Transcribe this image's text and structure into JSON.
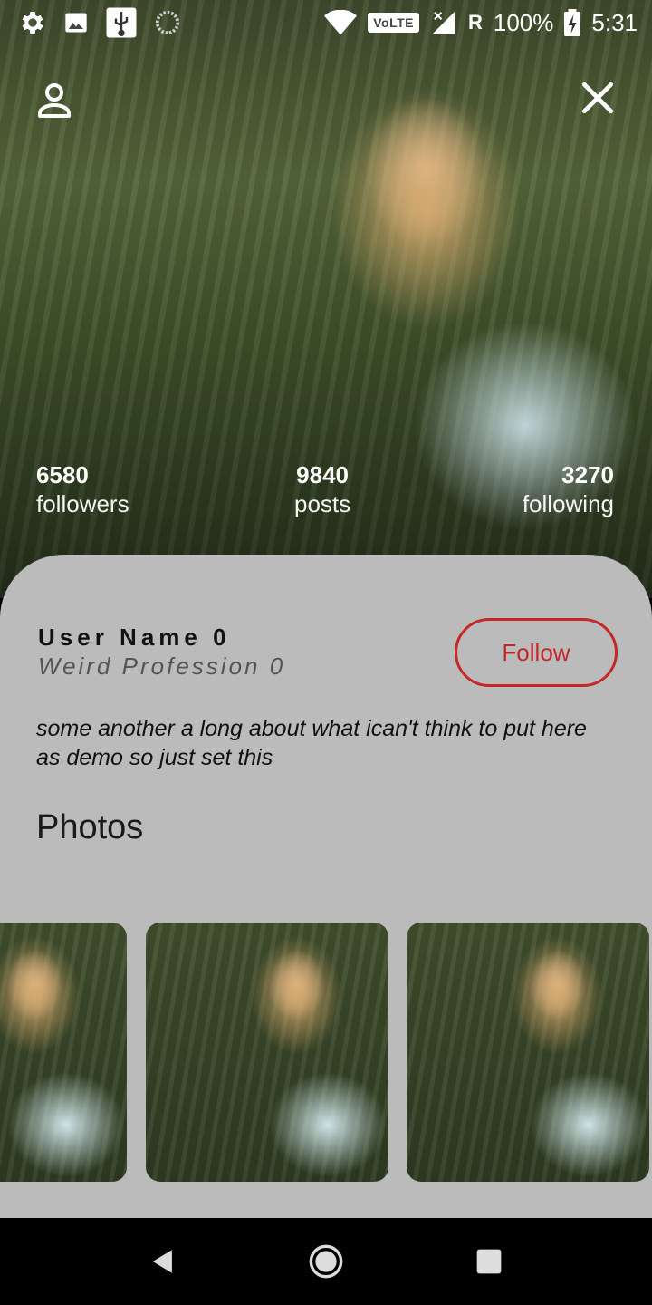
{
  "status_bar": {
    "icons": [
      "settings-icon",
      "image-icon",
      "usb-icon",
      "sync-icon"
    ],
    "network_icons": [
      "wifi-icon",
      "signal-icon"
    ],
    "volte": "VoLTE",
    "roaming": "R",
    "battery": "100%",
    "time": "5:31"
  },
  "header": {
    "profile_icon": "person-outline-icon",
    "close_icon": "close-icon"
  },
  "stats": {
    "followers_count": "6580",
    "followers_label": "followers",
    "posts_count": "9840",
    "posts_label": "posts",
    "following_count": "3270",
    "following_label": "following"
  },
  "profile": {
    "name": "User Name 0",
    "profession": "Weird Profession 0",
    "follow_label": "Follow",
    "bio": "some another a long about what ican't think to put here as demo so just set this"
  },
  "photos": {
    "title": "Photos",
    "count_visible": 3
  },
  "nav_bar": {
    "buttons": [
      "back-icon",
      "home-icon",
      "recents-icon"
    ]
  },
  "colors": {
    "accent": "#c62828",
    "card_background": "#bbbbbb",
    "nav_background": "#000000"
  }
}
